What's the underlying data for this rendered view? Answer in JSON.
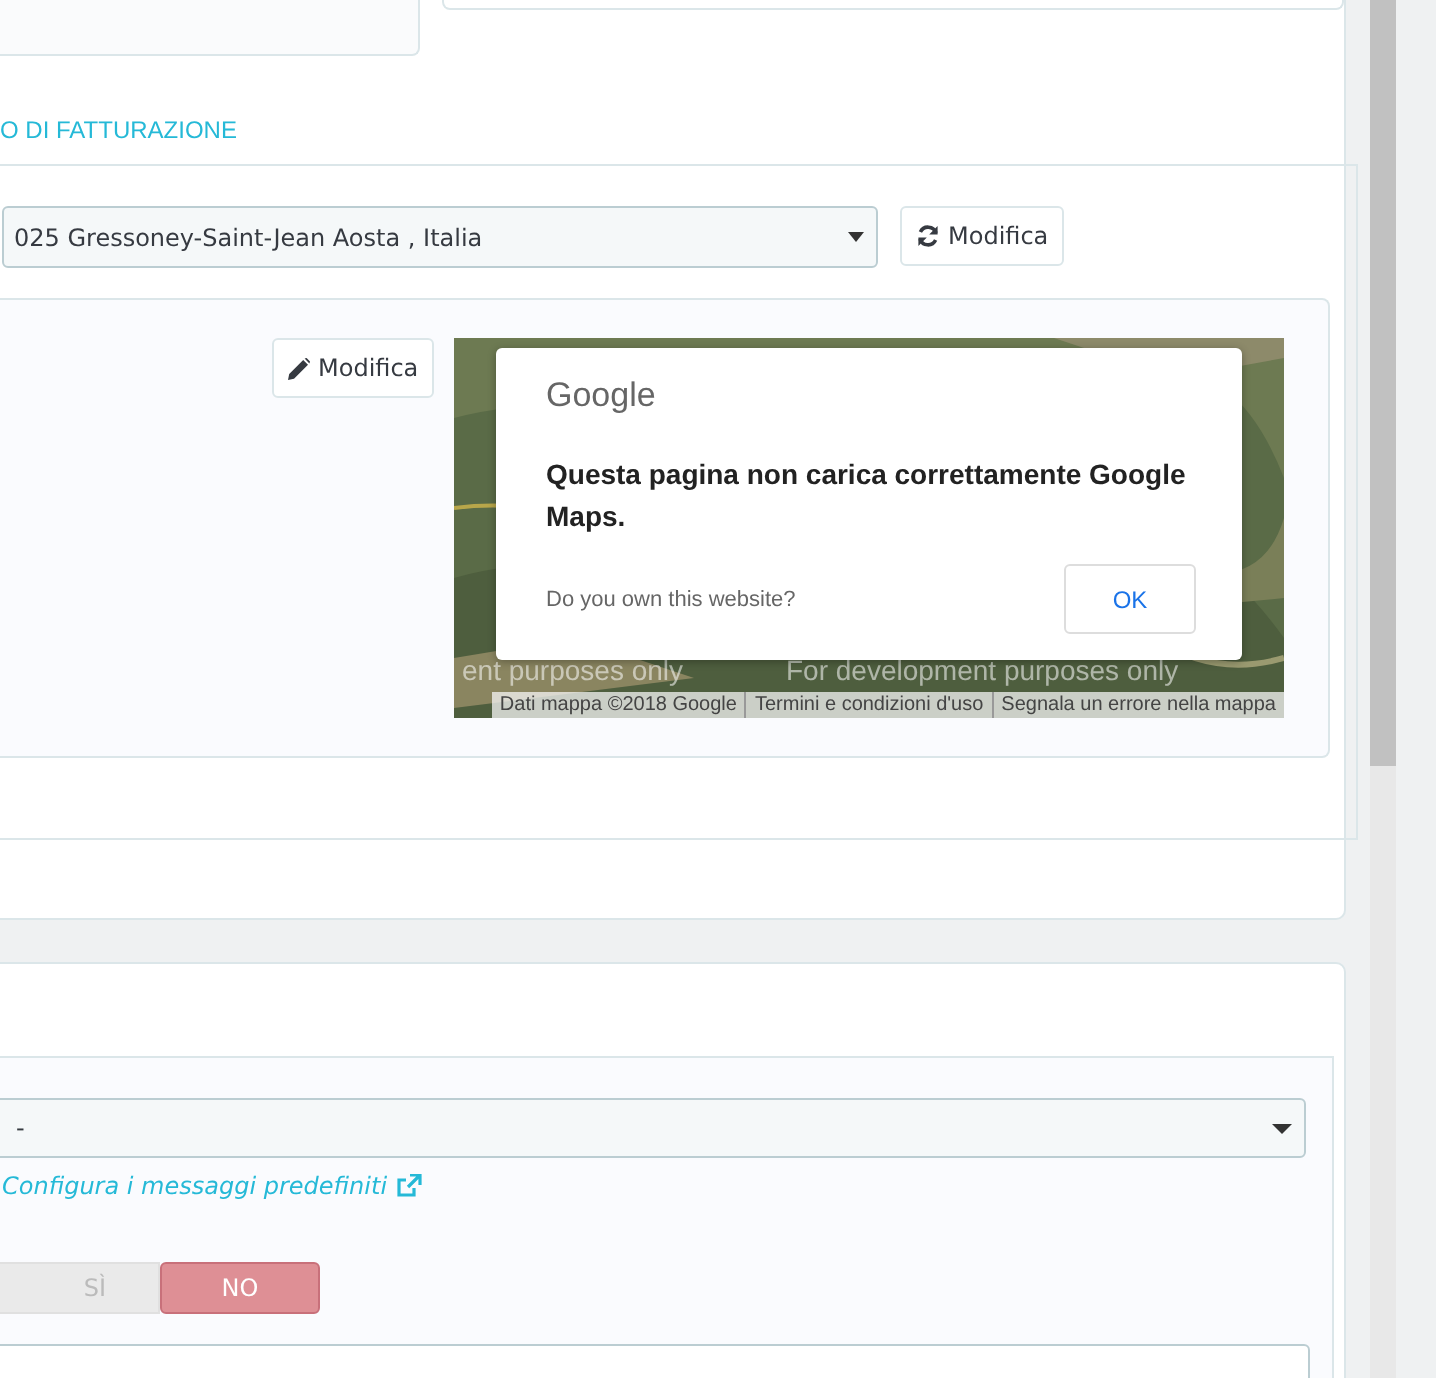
{
  "billing_heading": "O DI FATTURAZIONE",
  "address_select": {
    "value": "025 Gressoney-Saint-Jean Aosta , Italia"
  },
  "change_address_button": "Modifica",
  "edit_button": "Modifica",
  "map": {
    "watermarks": [
      "ent purposes only",
      "For development purposes only"
    ],
    "attribution": [
      "Dati mappa ©2018 Google",
      "Termini e condizioni d'uso",
      "Segnala un errore nella mappa"
    ],
    "dialog": {
      "logo": "Google",
      "message": "Questa pagina non carica correttamente Google Maps.",
      "question": "Do you own this website?",
      "ok_button": "OK"
    }
  },
  "message_select": {
    "value": "-"
  },
  "configure_link": "Configura i messaggi predefiniti",
  "toggle": [
    {
      "label": "SÌ",
      "selected": false
    },
    {
      "label": "NO",
      "selected": true
    }
  ]
}
